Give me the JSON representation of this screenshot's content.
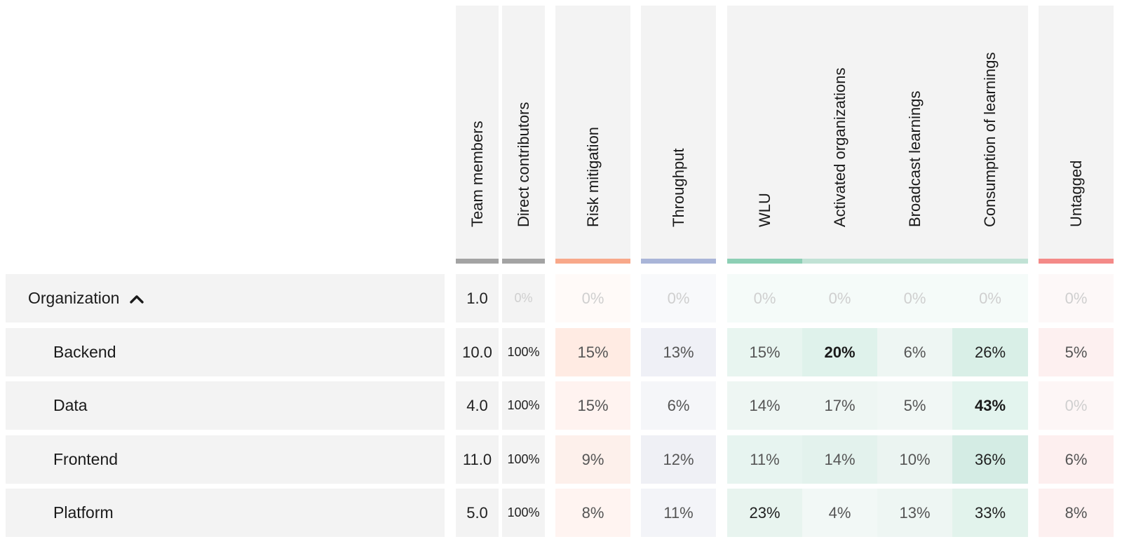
{
  "colors": {
    "header_bg": "#f3f3f3",
    "neutral_bar": "#a3a3a3",
    "risk_bar": "#f8a88a",
    "throughput_bar": "#a9b5d8",
    "wlu_bar": "#8dcfb5",
    "learning_bar": "#c1e2d5",
    "untagged_bar": "#f48a88"
  },
  "columns": [
    {
      "key": "team_members",
      "label": "Team members",
      "group": "neutral"
    },
    {
      "key": "direct_contributors",
      "label": "Direct contributors",
      "group": "neutral"
    },
    {
      "key": "risk_mitigation",
      "label": "Risk mitigation",
      "group": "risk"
    },
    {
      "key": "throughput",
      "label": "Throughput",
      "group": "throughput"
    },
    {
      "key": "wlu",
      "label": "WLU",
      "group": "learning"
    },
    {
      "key": "activated_organizations",
      "label": "Activated organizations",
      "group": "learning"
    },
    {
      "key": "broadcast_learnings",
      "label": "Broadcast learnings",
      "group": "learning"
    },
    {
      "key": "consumption_of_learnings",
      "label": "Consumption of learnings",
      "group": "learning"
    },
    {
      "key": "untagged",
      "label": "Untagged",
      "group": "untagged"
    }
  ],
  "rows": [
    {
      "name": "Organization",
      "is_parent": true,
      "expanded": true,
      "icon": "chevron-up-icon",
      "values": [
        "1.0",
        "0%",
        "0%",
        "0%",
        "0%",
        "0%",
        "0%",
        "0%",
        "0%"
      ],
      "weights": [
        "reg",
        "faint",
        "faint",
        "faint",
        "faint",
        "faint",
        "faint",
        "faint",
        "faint"
      ],
      "shades": [
        "#f3f3f3",
        "#f3f3f3",
        "#fffaf8",
        "#f8f9fb",
        "#f5fbf9",
        "#f5fbf9",
        "#f5fbf9",
        "#f5fbf9",
        "#fdf8f8"
      ]
    },
    {
      "name": "Backend",
      "is_parent": false,
      "values": [
        "10.0",
        "100%",
        "15%",
        "13%",
        "15%",
        "20%",
        "6%",
        "26%",
        "5%"
      ],
      "weights": [
        "reg",
        "reg",
        "light",
        "light",
        "light",
        "bold",
        "light",
        "reg",
        "light"
      ],
      "shades": [
        "#f3f3f3",
        "#f3f3f3",
        "#ffebe3",
        "#eff0f6",
        "#e8f5f0",
        "#dff2eb",
        "#eef6f3",
        "#d9efe7",
        "#fdf0f0"
      ]
    },
    {
      "name": "Data",
      "is_parent": false,
      "values": [
        "4.0",
        "100%",
        "15%",
        "6%",
        "14%",
        "17%",
        "5%",
        "43%",
        "0%"
      ],
      "weights": [
        "reg",
        "reg",
        "light",
        "light",
        "light",
        "light",
        "light",
        "bold",
        "faint"
      ],
      "shades": [
        "#f3f3f3",
        "#f3f3f3",
        "#fff3f0",
        "#f5f6f9",
        "#eef6f3",
        "#eef6f3",
        "#f1f7f5",
        "#e3f4ee",
        "#fdf6f6"
      ]
    },
    {
      "name": "Frontend",
      "is_parent": false,
      "values": [
        "11.0",
        "100%",
        "9%",
        "12%",
        "11%",
        "14%",
        "10%",
        "36%",
        "6%"
      ],
      "weights": [
        "reg",
        "reg",
        "light",
        "light",
        "light",
        "light",
        "light",
        "reg",
        "light"
      ],
      "shades": [
        "#f3f3f3",
        "#f3f3f3",
        "#fdf0eb",
        "#eff0f5",
        "#e7f4f0",
        "#e3f2ed",
        "#ebf4f1",
        "#d4ece4",
        "#fdefef"
      ]
    },
    {
      "name": "Platform",
      "is_parent": false,
      "values": [
        "5.0",
        "100%",
        "8%",
        "11%",
        "23%",
        "4%",
        "13%",
        "33%",
        "8%"
      ],
      "weights": [
        "reg",
        "reg",
        "light",
        "light",
        "reg",
        "light",
        "light",
        "reg",
        "light"
      ],
      "shades": [
        "#f3f3f3",
        "#f3f3f3",
        "#fff4f1",
        "#f3f4f8",
        "#e8f4ef",
        "#f2f8f6",
        "#eef6f3",
        "#e2f3ec",
        "#fdf0f0"
      ]
    }
  ]
}
